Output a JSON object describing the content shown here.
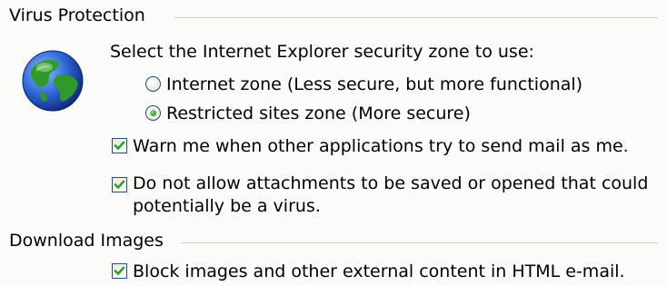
{
  "virus_protection": {
    "group_title": "Virus Protection",
    "zone_prompt": "Select the Internet Explorer security zone to use:",
    "zone_options": [
      {
        "label": "Internet zone (Less secure, but more functional)",
        "selected": false
      },
      {
        "label": "Restricted sites zone (More secure)",
        "selected": true
      }
    ],
    "warn_mail": {
      "label": "Warn me when other applications try to send mail as me.",
      "checked": true
    },
    "block_attachments": {
      "label_line1": "Do not allow attachments to be saved or opened that could",
      "label_line2": "potentially be a virus.",
      "checked": true
    },
    "icon": "globe-icon"
  },
  "download_images": {
    "group_title": "Download Images",
    "block_images": {
      "label": "Block images and other external content in HTML e-mail.",
      "checked": true
    }
  },
  "colors": {
    "background": "#fbfbf9",
    "control_border": "#1c5180",
    "check_mark": "#21a121",
    "group_rule": "#d0d0bf"
  }
}
